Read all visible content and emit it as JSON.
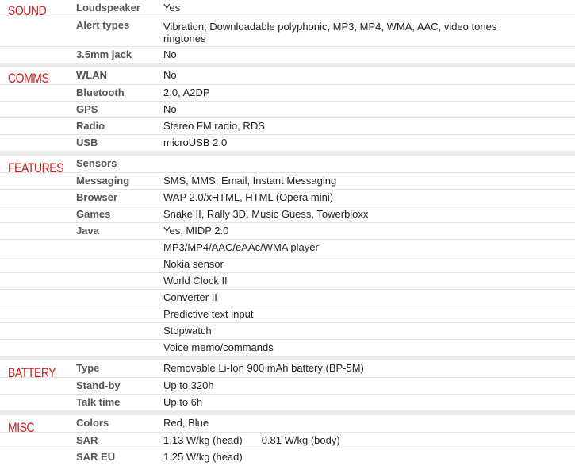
{
  "sections": [
    {
      "title": "SOUND",
      "rows": [
        {
          "label": "Loudspeaker",
          "value": "Yes"
        },
        {
          "label": "Alert types",
          "value": "Vibration; Downloadable polyphonic, MP3, MP4, WMA, AAC, video tones ringtones"
        },
        {
          "label": "3.5mm jack",
          "value": "No"
        }
      ]
    },
    {
      "title": "COMMS",
      "rows": [
        {
          "label": "WLAN",
          "value": "No"
        },
        {
          "label": "Bluetooth",
          "value": "2.0, A2DP"
        },
        {
          "label": "GPS",
          "value": "No"
        },
        {
          "label": "Radio",
          "value": "Stereo FM radio, RDS"
        },
        {
          "label": "USB",
          "value": "microUSB 2.0"
        }
      ]
    },
    {
      "title": "FEATURES",
      "rows": [
        {
          "label": "Sensors",
          "value": ""
        },
        {
          "label": "Messaging",
          "value": "SMS, MMS, Email, Instant Messaging"
        },
        {
          "label": "Browser",
          "value": "WAP 2.0/xHTML, HTML (Opera mini)"
        },
        {
          "label": "Games",
          "value": "Snake II, Rally 3D, Music Guess, Towerbloxx"
        },
        {
          "label": "Java",
          "value": "Yes, MIDP 2.0"
        },
        {
          "label": "",
          "value": "MP3/MP4/AAC/eAAc/WMA player"
        },
        {
          "label": "",
          "value": "Nokia sensor"
        },
        {
          "label": "",
          "value": "World Clock II"
        },
        {
          "label": "",
          "value": "Converter II"
        },
        {
          "label": "",
          "value": "Predictive text input"
        },
        {
          "label": "",
          "value": "Stopwatch"
        },
        {
          "label": "",
          "value": "Voice memo/commands"
        }
      ]
    },
    {
      "title": "BATTERY",
      "rows": [
        {
          "label": "Type",
          "value": "Removable Li-Ion 900 mAh battery (BP-5M)"
        },
        {
          "label": "Stand-by",
          "value": "Up to 320h"
        },
        {
          "label": "Talk time",
          "value": "Up to 6h"
        }
      ]
    },
    {
      "title": "MISC",
      "rows": [
        {
          "label": "Colors",
          "value": "Red, Blue"
        },
        {
          "label": "SAR",
          "value": "1.13 W/kg (head)",
          "value2": "0.81 W/kg (body)"
        },
        {
          "label": "SAR EU",
          "value": "1.25 W/kg (head)"
        }
      ]
    }
  ]
}
